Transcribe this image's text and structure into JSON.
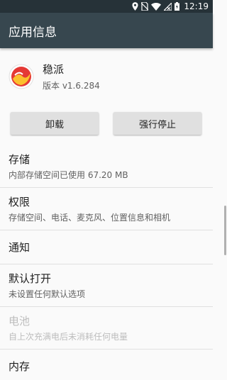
{
  "status_bar": {
    "time": "12:19"
  },
  "app_bar": {
    "title": "应用信息"
  },
  "app": {
    "name": "稳派",
    "version": "版本 v1.6.284"
  },
  "buttons": {
    "uninstall": "卸载",
    "force_stop": "强行停止"
  },
  "settings": [
    {
      "title": "存储",
      "subtitle": "内部存储空间已使用 67.20 MB"
    },
    {
      "title": "权限",
      "subtitle": "存储空间、电话、麦克风、位置信息和相机"
    },
    {
      "title": "通知"
    },
    {
      "title": "默认打开",
      "subtitle": "未设置任何默认选项"
    },
    {
      "title": "电池",
      "subtitle": "自上次充满电后未消耗任何电量"
    },
    {
      "title": "内存"
    }
  ]
}
